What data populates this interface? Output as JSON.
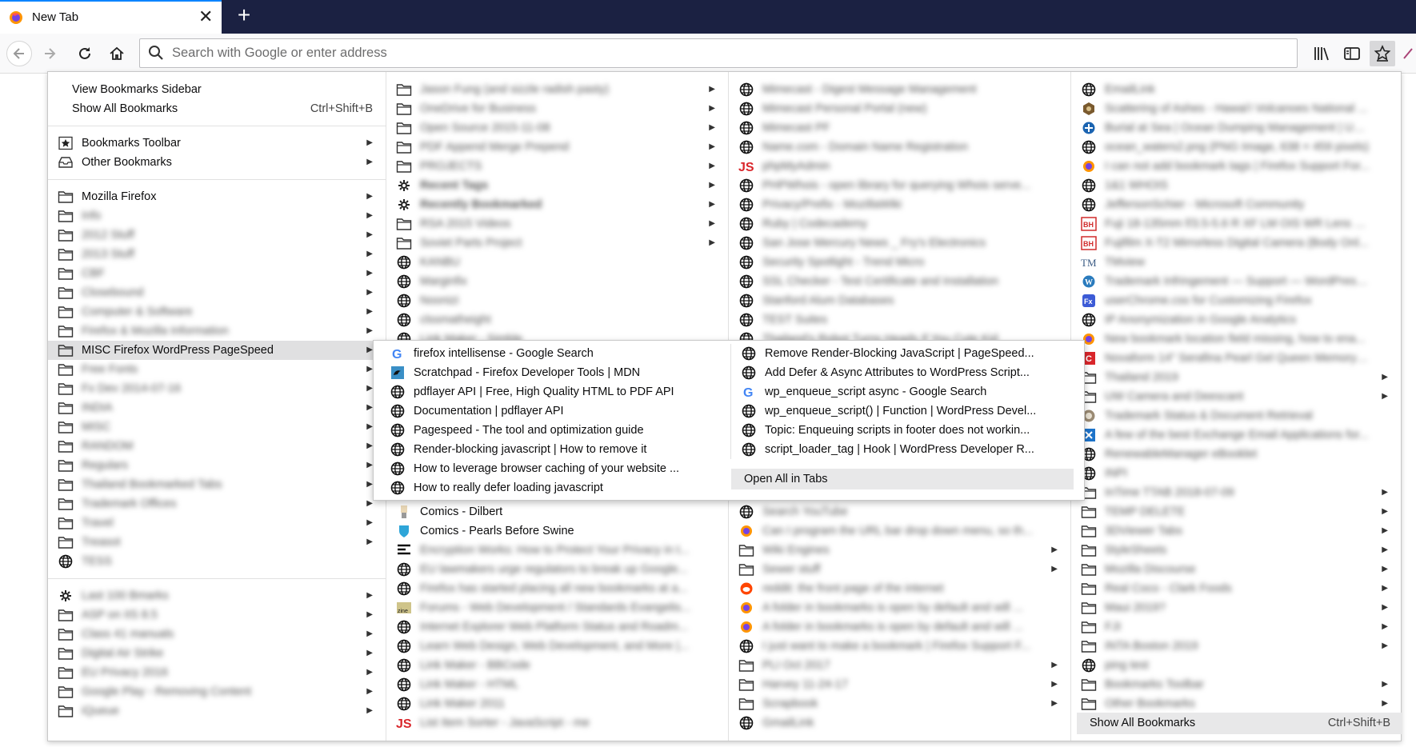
{
  "tab": {
    "title": "New Tab"
  },
  "urlbar": {
    "placeholder": "Search with Google or enter address"
  },
  "panel": {
    "col1": [
      {
        "t": "View Bookmarks Sidebar",
        "icon": "",
        "sub": false
      },
      {
        "t": "Show All Bookmarks",
        "sc": "Ctrl+Shift+B",
        "icon": ""
      },
      {
        "sep": true
      },
      {
        "t": "Bookmarks Toolbar",
        "icon": "star",
        "sub": true
      },
      {
        "t": "Other Bookmarks",
        "icon": "tray",
        "sub": true
      },
      {
        "sep": true
      },
      {
        "t": "Mozilla Firefox",
        "icon": "folder",
        "sub": true
      },
      {
        "t": "Info",
        "icon": "folder",
        "sub": true,
        "blur": true
      },
      {
        "t": "2012 Stuff",
        "icon": "folder",
        "sub": true,
        "blur": true
      },
      {
        "t": "2013 Stuff",
        "icon": "folder",
        "sub": true,
        "blur": true
      },
      {
        "t": "CBF",
        "icon": "folder",
        "sub": true,
        "blur": true
      },
      {
        "t": "Closebound",
        "icon": "folder",
        "sub": true,
        "blur": true
      },
      {
        "t": "Computer & Software",
        "icon": "folder",
        "sub": true,
        "blur": true
      },
      {
        "t": "Firefox & Mozilla Information",
        "icon": "folder",
        "sub": true,
        "blur": true
      },
      {
        "t": "MISC Firefox WordPress PageSpeed",
        "icon": "folder",
        "sub": true,
        "hl": true
      },
      {
        "t": "Free Fonts",
        "icon": "folder",
        "sub": true,
        "blur": true
      },
      {
        "t": "Fx Dev 2014-07-16",
        "icon": "folder",
        "sub": true,
        "blur": true
      },
      {
        "t": "INDIA",
        "icon": "folder",
        "sub": true,
        "blur": true
      },
      {
        "t": "MISC",
        "icon": "folder",
        "sub": true,
        "blur": true
      },
      {
        "t": "RANDOM",
        "icon": "folder",
        "sub": true,
        "blur": true
      },
      {
        "t": "Regulars",
        "icon": "folder",
        "sub": true,
        "blur": true
      },
      {
        "t": "Thailand Bookmarked Tabs",
        "icon": "folder",
        "sub": true,
        "blur": true
      },
      {
        "t": "Trademark Offices",
        "icon": "folder",
        "sub": true,
        "blur": true
      },
      {
        "t": "Travel",
        "icon": "folder",
        "sub": true,
        "blur": true
      },
      {
        "t": "Treasot",
        "icon": "folder",
        "sub": true,
        "blur": true
      },
      {
        "t": "TESS",
        "icon": "globe",
        "blur": true
      },
      {
        "sep": true
      },
      {
        "t": "Last 100 Bmarks",
        "icon": "gear",
        "sub": true,
        "blur": true
      },
      {
        "t": "ASP on IIS 8.5",
        "icon": "folder",
        "sub": true,
        "blur": true
      },
      {
        "t": "Class 41 manuals",
        "icon": "folder",
        "sub": true,
        "blur": true
      },
      {
        "t": "Digital Air Strike",
        "icon": "folder",
        "sub": true,
        "blur": true
      },
      {
        "t": "EU Privacy 2016",
        "icon": "folder",
        "sub": true,
        "blur": true
      },
      {
        "t": "Google Play - Removing Content",
        "icon": "folder",
        "sub": true,
        "blur": true
      },
      {
        "t": "iQueue",
        "icon": "folder",
        "sub": true,
        "blur": true
      }
    ],
    "col2": [
      {
        "t": "Jason Fung (and sizzle radish pasty)",
        "icon": "folder",
        "sub": true,
        "blur": true
      },
      {
        "t": "OneDrive for Business",
        "icon": "folder",
        "sub": true,
        "blur": true
      },
      {
        "t": "Open Source 2015-11-08",
        "icon": "folder",
        "sub": true,
        "blur": true
      },
      {
        "t": "PDF Append Merge Prepend",
        "icon": "folder",
        "sub": true,
        "blur": true
      },
      {
        "t": "PROJECTS",
        "icon": "folder",
        "sub": true,
        "blur": true
      },
      {
        "t": "Recent Tags",
        "icon": "gear",
        "sub": true,
        "blur": true,
        "bold": true
      },
      {
        "t": "Recently Bookmarked",
        "icon": "gear",
        "sub": true,
        "blur": true,
        "bold": true
      },
      {
        "t": "RSA 2015 Videos",
        "icon": "folder",
        "sub": true,
        "blur": true
      },
      {
        "t": "Soviet Parts Project",
        "icon": "folder",
        "sub": true,
        "blur": true
      },
      {
        "t": "KANBU",
        "icon": "globe",
        "blur": true
      },
      {
        "t": "Marginfix",
        "icon": "globe",
        "blur": true
      },
      {
        "t": "Noonizi",
        "icon": "globe",
        "blur": true
      },
      {
        "t": "clssmatheight",
        "icon": "globe",
        "blur": true
      },
      {
        "t": "Link Maker - Simble",
        "icon": "globe",
        "blur": true
      },
      {
        "gap": true
      },
      {
        "gap": true
      },
      {
        "gap": true
      },
      {
        "gap": true
      },
      {
        "gap": true
      },
      {
        "gap": true
      },
      {
        "gap": true
      },
      {
        "gap": true
      },
      {
        "t": "Comics - Dilbert",
        "icon": "dilbert"
      },
      {
        "t": "Comics - Pearls Before Swine",
        "icon": "shield"
      },
      {
        "t": "Encryption Works: How to Protect Your Privacy in t...",
        "icon": "lines",
        "blur": true
      },
      {
        "t": "EU lawmakers urge regulators to break up Google...",
        "icon": "globe",
        "blur": true
      },
      {
        "t": "Firefox has started placing all new bookmarks at a...",
        "icon": "globe",
        "blur": true
      },
      {
        "t": "Forums - Web Development / Standards Evangelis...",
        "icon": "zine",
        "blur": true
      },
      {
        "t": "Internet Explorer Web Platform Status and Roadm...",
        "icon": "globe",
        "blur": true
      },
      {
        "t": "Learn Web Design, Web Development, and More |...",
        "icon": "globe",
        "blur": true
      },
      {
        "t": "Link Maker - BBCode",
        "icon": "globe",
        "blur": true
      },
      {
        "t": "Link Maker - HTML",
        "icon": "globe",
        "blur": true
      },
      {
        "t": "Link Maker 2011",
        "icon": "globe",
        "blur": true
      },
      {
        "t": "List Item Sorter - JavaScript - me",
        "icon": "js",
        "blur": true
      }
    ],
    "col3": [
      {
        "t": "Mimecast - Digest Message Management",
        "icon": "globe",
        "blur": true
      },
      {
        "t": "Mimecast Personal Portal (new)",
        "icon": "globe",
        "blur": true
      },
      {
        "t": "Mimecast PF",
        "icon": "globe",
        "blur": true
      },
      {
        "t": "Name.com - Domain Name Registration",
        "icon": "globe",
        "blur": true
      },
      {
        "t": "phpMyAdmin",
        "icon": "js",
        "blur": true
      },
      {
        "t": "PHPWhois - open library for querying Whois serve...",
        "icon": "globe",
        "blur": true
      },
      {
        "t": "Privacy/Prefix - MozillaWiki",
        "icon": "globe",
        "blur": true
      },
      {
        "t": "Ruby | Codecademy",
        "icon": "globe",
        "blur": true
      },
      {
        "t": "San Jose Mercury News _ Fry's Electronics",
        "icon": "globe",
        "blur": true
      },
      {
        "t": "Security Spotlight - Trend Micro",
        "icon": "globe",
        "blur": true
      },
      {
        "t": "SSL Checker - Test Certificate and Installation",
        "icon": "globe",
        "blur": true
      },
      {
        "t": "Stanford Alum Databases",
        "icon": "globe",
        "blur": true
      },
      {
        "t": "TEST Suites",
        "icon": "globe",
        "blur": true
      },
      {
        "t": "Thailand's Robot Turns Heads If You Cute Kid",
        "icon": "globe",
        "blur": true
      },
      {
        "gap": true
      },
      {
        "gap": true
      },
      {
        "gap": true
      },
      {
        "gap": true
      },
      {
        "gap": true
      },
      {
        "gap": true
      },
      {
        "gap": true
      },
      {
        "gap": true
      },
      {
        "t": "Search YouTube",
        "icon": "globe",
        "blur": true
      },
      {
        "t": "Can I program the URL bar drop down menu, so th...",
        "icon": "firefox",
        "blur": true
      },
      {
        "t": "Wiki Engines",
        "icon": "folder",
        "sub": true,
        "blur": true
      },
      {
        "t": "Sewer stuff",
        "icon": "folder",
        "sub": true,
        "blur": true
      },
      {
        "t": "reddit: the front page of the internet",
        "icon": "reddit",
        "blur": true
      },
      {
        "t": "A folder in bookmarks is open by default and will ...",
        "icon": "firefox",
        "blur": true
      },
      {
        "t": "A folder in bookmarks is open by default and will ...",
        "icon": "firefox",
        "blur": true
      },
      {
        "t": "I just want to make a bookmark | Firefox Support F...",
        "icon": "globe",
        "blur": true
      },
      {
        "t": "PLI Oct 2017",
        "icon": "folder",
        "sub": true,
        "blur": true
      },
      {
        "t": "Harvey 11-24-17",
        "icon": "folder",
        "sub": true,
        "blur": true
      },
      {
        "t": "Scrapbook",
        "icon": "folder",
        "sub": true,
        "blur": true
      },
      {
        "t": "GmailLink",
        "icon": "globe",
        "blur": true
      }
    ],
    "col4": [
      {
        "t": "EmailLink",
        "icon": "globe",
        "blur": true
      },
      {
        "t": "Scattering of Ashes - Hawai'i Volcanoes National ...",
        "icon": "badge",
        "blur": true
      },
      {
        "t": "Burial at Sea | Ocean Dumping Management | US ...",
        "icon": "epa",
        "blur": true
      },
      {
        "t": "ocean_waters2.png (PNG Image, 638 × 459 pixels)",
        "icon": "globe",
        "blur": true
      },
      {
        "t": "I can not add bookmark tags | Firefox Support For...",
        "icon": "firefox",
        "blur": true
      },
      {
        "t": "1&1 WHOIS",
        "icon": "globe",
        "blur": true
      },
      {
        "t": "JeffersonSchier - Microsoft Community",
        "icon": "globe",
        "blur": true
      },
      {
        "t": "Fuji 18-135mm f/3.5-5.6 R XF LM OIS WR Lens Fuji...",
        "icon": "bh",
        "blur": true
      },
      {
        "t": "Fujifilm X-T2 Mirrorless Digital Camera (Body Onl...",
        "icon": "bh",
        "blur": true
      },
      {
        "t": "TMview",
        "icon": "tm",
        "blur": true
      },
      {
        "t": "Trademark Infringement — Support — WordPress...",
        "icon": "wp",
        "blur": true
      },
      {
        "t": "userChrome.css for Customizing Firefox",
        "icon": "fx",
        "blur": true
      },
      {
        "t": "IP Anonymization in Google Analytics",
        "icon": "globe",
        "blur": true
      },
      {
        "t": "New bookmark location field missing, how to ena...",
        "icon": "firefox",
        "blur": true
      },
      {
        "t": "Novaform 14\" Serafina Pearl Gel Queen Memory F...",
        "icon": "costco",
        "blur": true
      },
      {
        "t": "Thailand 2019",
        "icon": "folder",
        "sub": true,
        "blur": true
      },
      {
        "t": "UW Camera and Deescant",
        "icon": "folder",
        "sub": true,
        "blur": true
      },
      {
        "t": "Trademark Status & Document Retrieval",
        "icon": "seal",
        "blur": true
      },
      {
        "t": "A few of the best Exchange Email Applications for...",
        "icon": "xicon",
        "blur": true
      },
      {
        "t": "RenewableManager eBooklet",
        "icon": "globe",
        "blur": true
      },
      {
        "t": "INPI",
        "icon": "globe",
        "blur": true
      },
      {
        "t": "InTime TTAB 2018-07-09",
        "icon": "folder",
        "sub": true,
        "blur": true
      },
      {
        "t": "TEMP DELETE",
        "icon": "folder",
        "sub": true,
        "blur": true
      },
      {
        "t": "3DViewer Tabs",
        "icon": "folder",
        "sub": true,
        "blur": true
      },
      {
        "t": "StyleSheets",
        "icon": "folder",
        "sub": true,
        "blur": true
      },
      {
        "t": "Mozilla Discourse",
        "icon": "folder",
        "sub": true,
        "blur": true
      },
      {
        "t": "Real Coco - Clark Foods",
        "icon": "folder",
        "sub": true,
        "blur": true
      },
      {
        "t": "Maui 2019?",
        "icon": "folder",
        "sub": true,
        "blur": true
      },
      {
        "t": "FJI",
        "icon": "folder",
        "sub": true,
        "blur": true
      },
      {
        "t": "INTA Boston 2019",
        "icon": "folder",
        "sub": true,
        "blur": true
      },
      {
        "t": "ping test",
        "icon": "globe",
        "blur": true
      },
      {
        "t": "Bookmarks Toolbar",
        "icon": "folder",
        "sub": true,
        "blur": true
      },
      {
        "t": "Other Bookmarks",
        "icon": "folder",
        "sub": true,
        "blur": true
      }
    ],
    "show_all": {
      "label": "Show All Bookmarks",
      "shortcut": "Ctrl+Shift+B"
    }
  },
  "submenu": {
    "col1": [
      {
        "t": "firefox intellisense - Google Search",
        "icon": "google"
      },
      {
        "t": "Scratchpad - Firefox Developer Tools | MDN",
        "icon": "mdn"
      },
      {
        "t": "pdflayer API | Free, High Quality HTML to PDF API",
        "icon": "globe"
      },
      {
        "t": "Documentation | pdflayer API",
        "icon": "globe"
      },
      {
        "t": "Pagespeed - The tool and optimization guide",
        "icon": "globe"
      },
      {
        "t": "Render-blocking javascript | How to remove it",
        "icon": "globe"
      },
      {
        "t": "How to leverage browser caching of your website ...",
        "icon": "globe"
      },
      {
        "t": "How to really defer loading javascript",
        "icon": "globe"
      }
    ],
    "col2": [
      {
        "t": "Remove Render-Blocking JavaScript  |  PageSpeed...",
        "icon": "globe"
      },
      {
        "t": "Add Defer & Async Attributes to WordPress Script...",
        "icon": "globe"
      },
      {
        "t": "wp_enqueue_script async - Google Search",
        "icon": "google"
      },
      {
        "t": "wp_enqueue_script() | Function | WordPress Devel...",
        "icon": "globe"
      },
      {
        "t": "Topic: Enqueuing scripts in footer does not workin...",
        "icon": "globe"
      },
      {
        "t": "script_loader_tag | Hook | WordPress Developer R...",
        "icon": "globe"
      }
    ],
    "open_all": "Open All in Tabs"
  }
}
